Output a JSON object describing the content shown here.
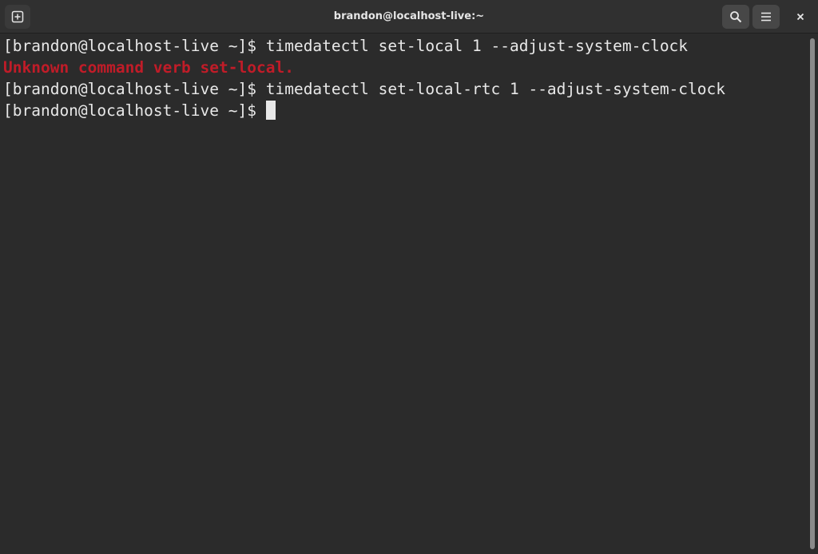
{
  "window": {
    "title": "brandon@localhost-live:~"
  },
  "icons": {
    "new_tab": "new-tab-icon",
    "search": "search-icon",
    "menu": "hamburger-menu-icon",
    "close": "close-icon"
  },
  "colors": {
    "background": "#2b2b2b",
    "titlebar": "#303030",
    "text": "#e8e8e8",
    "error": "#c01c28"
  },
  "terminal": {
    "lines": [
      {
        "prompt": "[brandon@localhost-live ~]$ ",
        "command": "timedatectl set-local 1 --adjust-system-clock"
      },
      {
        "error": "Unknown command verb set-local."
      },
      {
        "prompt": "[brandon@localhost-live ~]$ ",
        "command": "timedatectl set-local-rtc 1 --adjust-system-clock"
      },
      {
        "prompt": "[brandon@localhost-live ~]$",
        "command": ""
      }
    ]
  }
}
